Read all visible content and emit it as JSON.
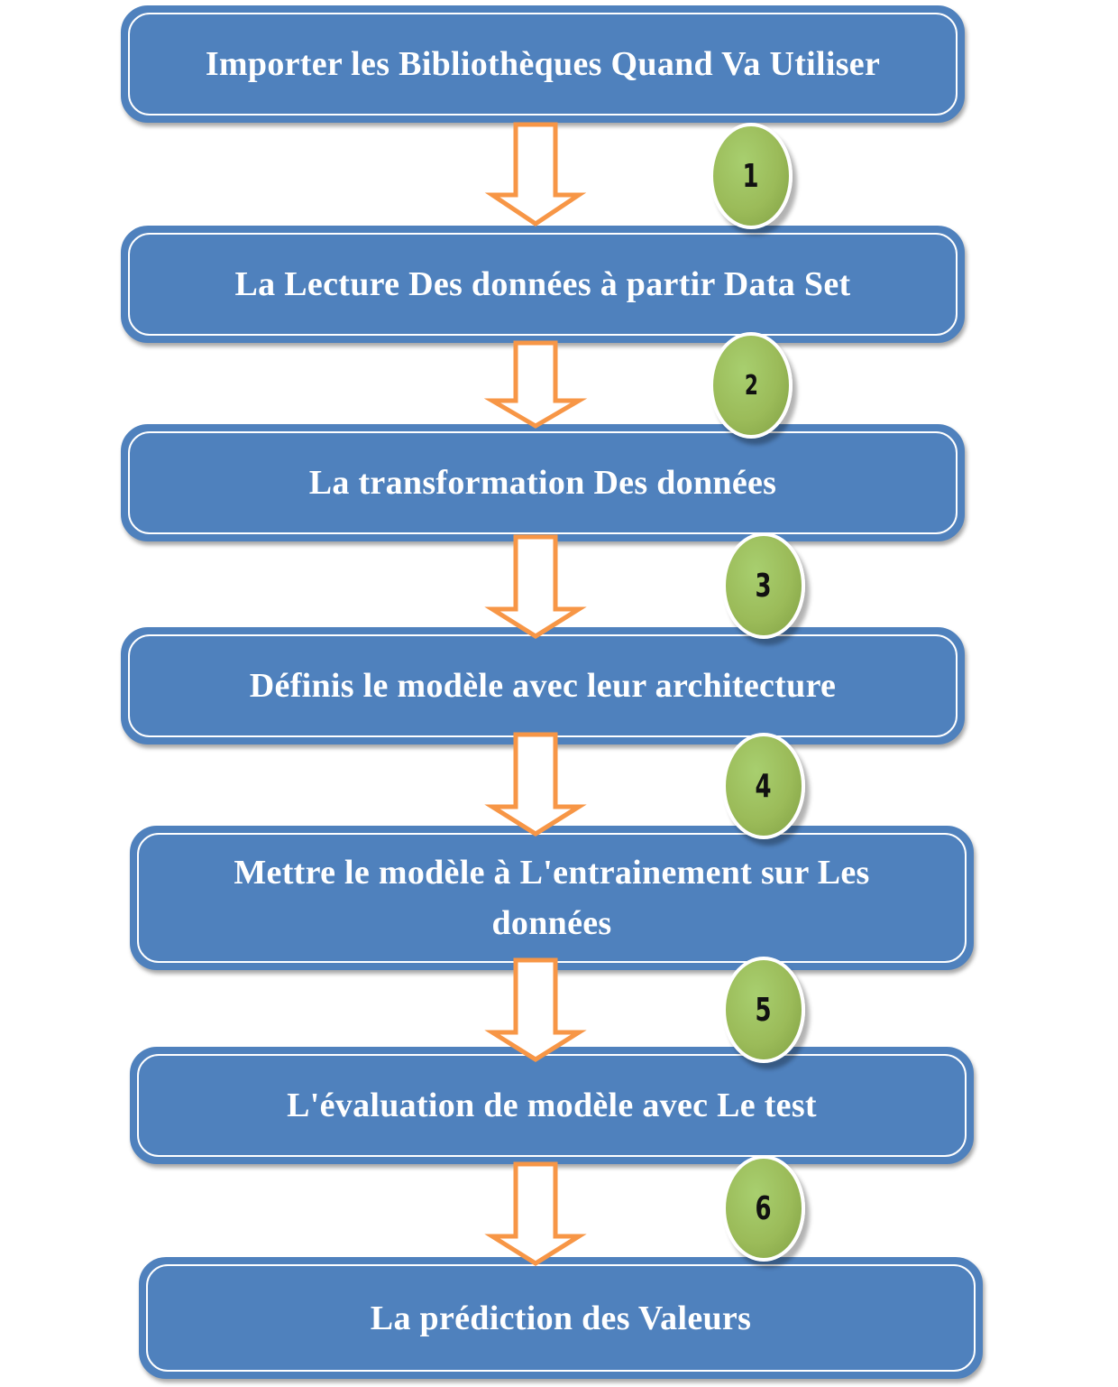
{
  "steps": [
    {
      "label": "Importer les Bibliothèques Quand Va Utiliser"
    },
    {
      "label": "La Lecture Des données à partir Data Set"
    },
    {
      "label": "La transformation Des données"
    },
    {
      "label": "Définis le modèle avec leur architecture"
    },
    {
      "label": "Mettre le modèle à L'entrainement sur Les données"
    },
    {
      "label": "L'évaluation de modèle avec Le test"
    },
    {
      "label": "La prédiction des Valeurs"
    }
  ],
  "badges": [
    "1",
    "2",
    "3",
    "4",
    "5",
    "6"
  ],
  "colors": {
    "box_fill": "#4f81bd",
    "box_text": "#ffffff",
    "arrow_stroke": "#f79646",
    "badge_fill": "#9bbb59",
    "badge_text": "#111111"
  }
}
